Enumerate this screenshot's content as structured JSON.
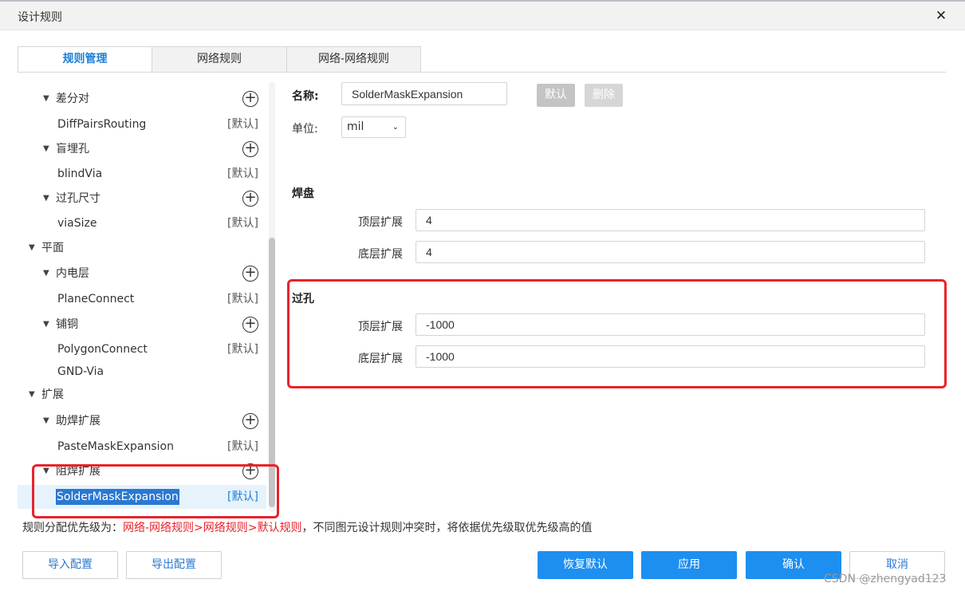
{
  "dialog": {
    "title": "设计规则",
    "close_symbol": "✕"
  },
  "tabs": [
    {
      "label": "规则管理",
      "active": true
    },
    {
      "label": "网络规则",
      "active": false
    },
    {
      "label": "网络-网络规则",
      "active": false
    }
  ],
  "tree": {
    "items": [
      {
        "label": "差分对",
        "has_add": true
      },
      {
        "label": "DiffPairsRouting",
        "tag": "[默认]"
      },
      {
        "label": "盲埋孔",
        "has_add": true
      },
      {
        "label": "blindVia",
        "tag": "[默认]"
      },
      {
        "label": "过孔尺寸",
        "has_add": true
      },
      {
        "label": "viaSize",
        "tag": "[默认]"
      },
      {
        "label": "平面"
      },
      {
        "label": "内电层",
        "has_add": true
      },
      {
        "label": "PlaneConnect",
        "tag": "[默认]"
      },
      {
        "label": "铺铜",
        "has_add": true
      },
      {
        "label": "PolygonConnect",
        "tag": "[默认]"
      },
      {
        "label": "GND-Via"
      },
      {
        "label": "扩展"
      },
      {
        "label": "助焊扩展",
        "has_add": true
      },
      {
        "label": "PasteMaskExpansion",
        "tag": "[默认]"
      },
      {
        "label": "阻焊扩展",
        "has_add": true
      },
      {
        "label": "SolderMaskExpansion",
        "tag": "[默认]",
        "selected": true
      }
    ],
    "add_symbol": "+",
    "caret_symbol": "▼"
  },
  "form": {
    "name_label": "名称:",
    "name_value": "SolderMaskExpansion",
    "default_button": "默认",
    "delete_button": "删除",
    "unit_label": "单位:",
    "unit_value": "mil",
    "unit_chevron": "⌄",
    "pad_section": {
      "title": "焊盘",
      "top_label": "顶层扩展",
      "top_value": "4",
      "bottom_label": "底层扩展",
      "bottom_value": "4"
    },
    "via_section": {
      "title": "过孔",
      "top_label": "顶层扩展",
      "top_value": "-1000",
      "bottom_label": "底层扩展",
      "bottom_value": "-1000"
    }
  },
  "hint": {
    "prefix": "规则分配优先级为：",
    "priority": "网络-网络规则>网络规则>默认规则",
    "suffix": "，不同图元设计规则冲突时，将依据优先级取优先级高的值"
  },
  "footer": {
    "import": "导入配置",
    "export": "导出配置",
    "restore": "恢复默认",
    "apply": "应用",
    "confirm": "确认",
    "cancel": "取消"
  },
  "watermark": "CSDN @zhengyad123",
  "colors": {
    "accent": "#1d8ff0",
    "annotation_red": "#e8232a",
    "selection": "#2b78d2"
  }
}
